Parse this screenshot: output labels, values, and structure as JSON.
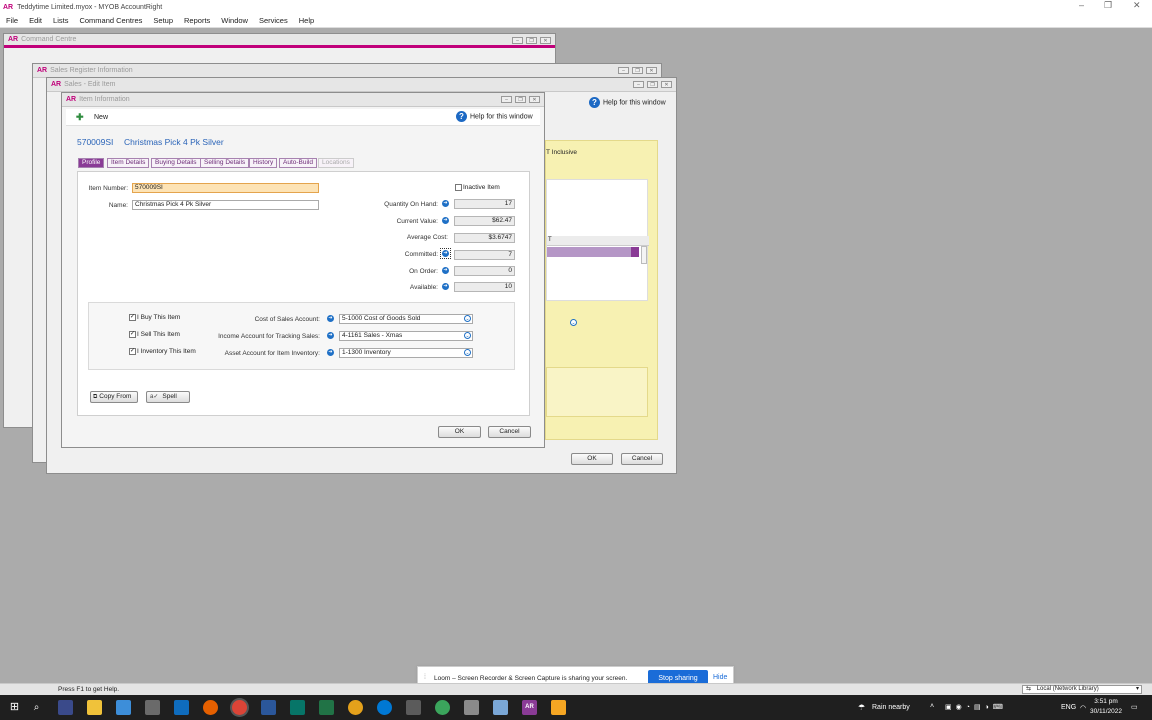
{
  "app": {
    "logo": "AR",
    "title": "Teddytime Limited.myox - MYOB AccountRight",
    "menu": [
      "File",
      "Edit",
      "Lists",
      "Command Centres",
      "Setup",
      "Reports",
      "Window",
      "Services",
      "Help"
    ]
  },
  "windows": {
    "command_centre": "Command Centre",
    "sales_register": "Sales Register Information",
    "sales_edit": "Sales - Edit Item",
    "item_info": "Item Information"
  },
  "sales_edit": {
    "help": "Help for this window",
    "gst_inclusive": "T Inclusive",
    "col_header": "T",
    "ok": "OK",
    "cancel": "Cancel"
  },
  "item": {
    "new_label": "New",
    "help": "Help for this window",
    "code": "570009SI",
    "name_header": "Christmas Pick 4 Pk Silver",
    "tabs": [
      "Profile",
      "Item Details",
      "Buying Details",
      "Selling Details",
      "History",
      "Auto-Build",
      "Locations"
    ],
    "item_number_label": "Item Number:",
    "item_number": "570009SI",
    "name_label": "Name:",
    "name": "Christmas Pick 4 Pk Silver",
    "inactive_label": "Inactive Item",
    "qty_label": "Quantity On Hand:",
    "qty": "17",
    "current_value_label": "Current Value:",
    "current_value": "$62.47",
    "avg_cost_label": "Average Cost:",
    "avg_cost": "$3.6747",
    "committed_label": "Committed:",
    "committed": "7",
    "on_order_label": "On Order:",
    "on_order": "0",
    "available_label": "Available:",
    "available": "10",
    "buy_label": "I Buy This Item",
    "sell_label": "I Sell This Item",
    "inventory_label": "I Inventory This Item",
    "cost_sales_label": "Cost of Sales Account:",
    "cost_sales": "5-1000 Cost of Goods Sold",
    "income_label": "Income Account for Tracking Sales:",
    "income": "4-1161 Sales - Xmas",
    "asset_label": "Asset Account for Item Inventory:",
    "asset": "1-1300 Inventory",
    "copy_from": "Copy From",
    "spell": "Spell",
    "ok": "OK",
    "cancel": "Cancel"
  },
  "status": {
    "hint": "Press F1 to get Help.",
    "network": "Local (Network Library)"
  },
  "loom": {
    "text": "Loom – Screen Recorder & Screen Capture is sharing your screen.",
    "stop": "Stop sharing",
    "hide": "Hide"
  },
  "taskbar": {
    "weather": "Rain nearby",
    "lang": "ENG",
    "time": "3:51 pm",
    "date": "30/11/2022"
  }
}
